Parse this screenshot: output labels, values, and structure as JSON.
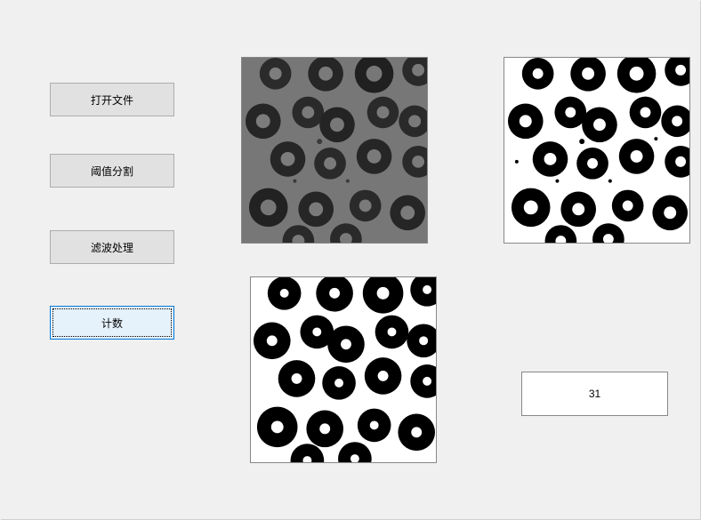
{
  "buttons": {
    "open_file": "打开文件",
    "threshold": "阈值分割",
    "filter": "滤波处理",
    "count": "计数"
  },
  "result": {
    "count_value": "31"
  },
  "images": {
    "original": "grayscale-cell-microscopy",
    "thresholded": "binary-cell-mask",
    "filtered": "binary-cell-mask-filtered"
  }
}
